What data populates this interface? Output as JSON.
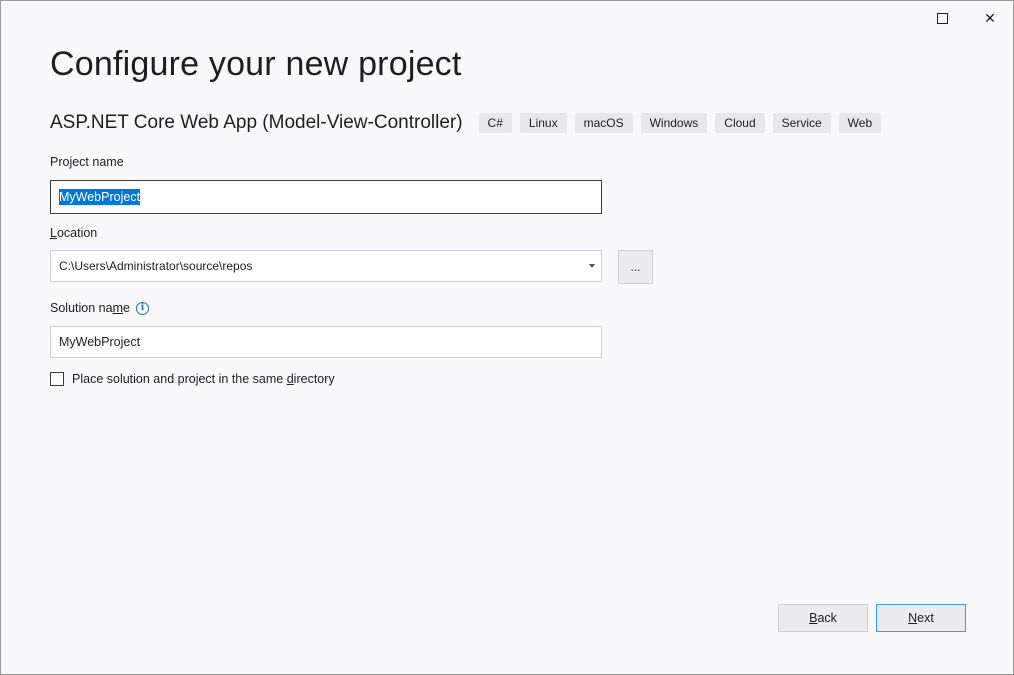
{
  "window": {
    "maximize_icon": "maximize-icon",
    "close_icon": "close-icon",
    "close_glyph": "✕"
  },
  "header": {
    "title": "Configure your new project",
    "template_name": "ASP.NET Core Web App (Model-View-Controller)",
    "tags": [
      "C#",
      "Linux",
      "macOS",
      "Windows",
      "Cloud",
      "Service",
      "Web"
    ]
  },
  "project_name": {
    "label": "Project name",
    "value": "MyWebProject"
  },
  "location": {
    "label_prefix": "",
    "label_underlined": "L",
    "label_rest": "ocation",
    "value": "C:\\Users\\Administrator\\source\\repos",
    "browse_label": "..."
  },
  "solution_name": {
    "label_prefix": "Solution na",
    "label_underlined": "m",
    "label_rest": "e",
    "info_glyph": "i",
    "value": "MyWebProject"
  },
  "same_directory": {
    "label_prefix": "Place solution and project in the same ",
    "label_underlined": "d",
    "label_rest": "irectory",
    "checked": false
  },
  "footer": {
    "back_underlined": "B",
    "back_rest": "ack",
    "next_underlined": "N",
    "next_rest": "ext"
  }
}
